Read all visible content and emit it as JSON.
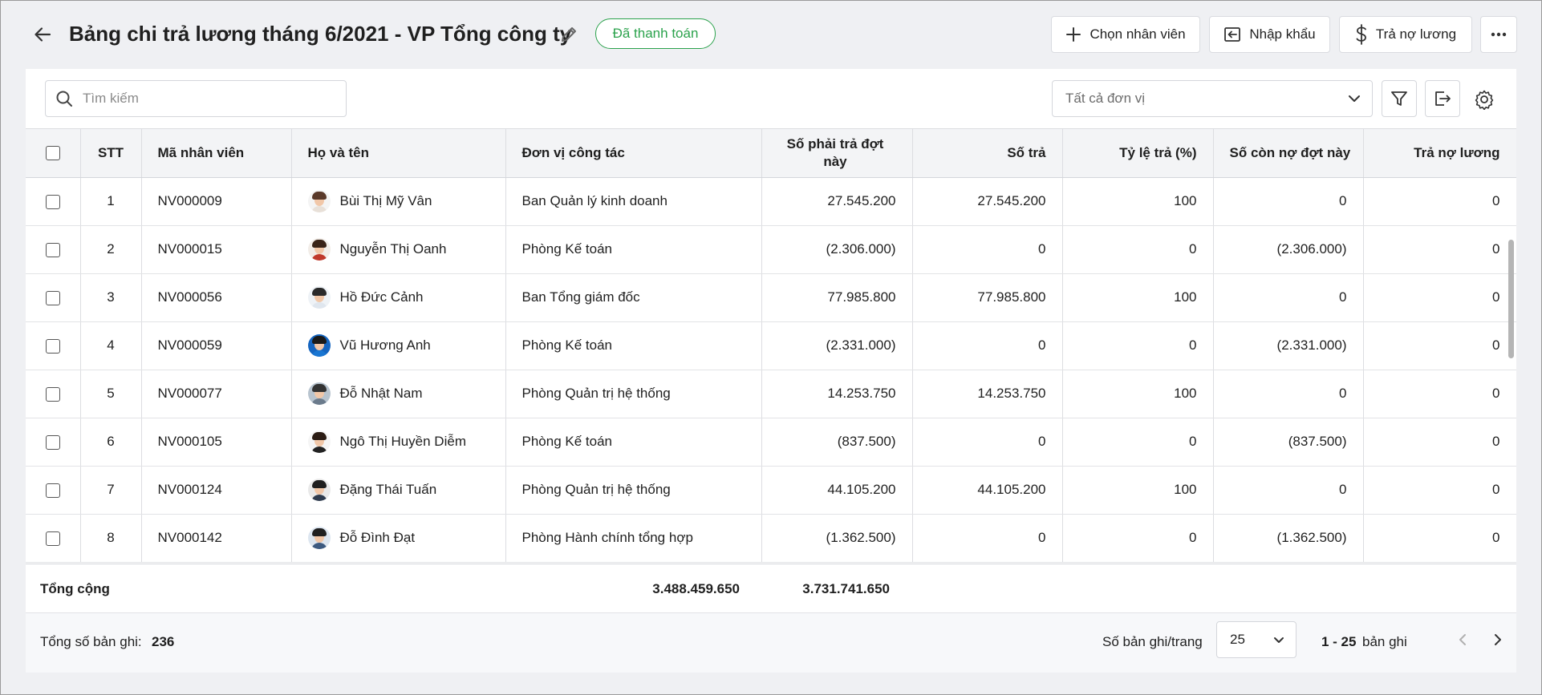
{
  "header": {
    "title": "Bảng chi trả lương tháng 6/2021 - VP Tổng công ty",
    "status": "Đã thanh toán",
    "buttons": {
      "choose_employee": "Chọn nhân viên",
      "import": "Nhập khẩu",
      "pay_debt": "Trả nợ lương"
    }
  },
  "toolbar": {
    "search_placeholder": "Tìm kiếm",
    "unit_filter": "Tất cả đơn vị"
  },
  "table": {
    "columns": {
      "stt": "STT",
      "code": "Mã nhân viên",
      "name": "Họ và tên",
      "unit": "Đơn vị công tác",
      "payable": "Số phải trả đợt này",
      "paid": "Số trả",
      "rate": "Tỷ lệ trả (%)",
      "remaining": "Số còn nợ đợt này",
      "debt_paid": "Trả nợ lương"
    },
    "rows": [
      {
        "stt": "1",
        "code": "NV000009",
        "name": "Bùi Thị Mỹ Vân",
        "unit": "Ban Quản lý kinh doanh",
        "payable": "27.545.200",
        "paid": "27.545.200",
        "rate": "100",
        "remaining": "0",
        "debt_paid": "0"
      },
      {
        "stt": "2",
        "code": "NV000015",
        "name": "Nguyễn Thị Oanh",
        "unit": "Phòng Kế toán",
        "payable": "(2.306.000)",
        "paid": "0",
        "rate": "0",
        "remaining": "(2.306.000)",
        "debt_paid": "0"
      },
      {
        "stt": "3",
        "code": "NV000056",
        "name": "Hồ Đức Cảnh",
        "unit": "Ban Tổng giám đốc",
        "payable": "77.985.800",
        "paid": "77.985.800",
        "rate": "100",
        "remaining": "0",
        "debt_paid": "0"
      },
      {
        "stt": "4",
        "code": "NV000059",
        "name": "Vũ Hương Anh",
        "unit": "Phòng Kế toán",
        "payable": "(2.331.000)",
        "paid": "0",
        "rate": "0",
        "remaining": "(2.331.000)",
        "debt_paid": "0"
      },
      {
        "stt": "5",
        "code": "NV000077",
        "name": "Đỗ Nhật Nam",
        "unit": "Phòng Quản trị hệ thống",
        "payable": "14.253.750",
        "paid": "14.253.750",
        "rate": "100",
        "remaining": "0",
        "debt_paid": "0"
      },
      {
        "stt": "6",
        "code": "NV000105",
        "name": "Ngô Thị Huyền Diễm",
        "unit": "Phòng Kế toán",
        "payable": "(837.500)",
        "paid": "0",
        "rate": "0",
        "remaining": "(837.500)",
        "debt_paid": "0"
      },
      {
        "stt": "7",
        "code": "NV000124",
        "name": "Đặng Thái Tuấn",
        "unit": "Phòng Quản trị hệ thống",
        "payable": "44.105.200",
        "paid": "44.105.200",
        "rate": "100",
        "remaining": "0",
        "debt_paid": "0"
      },
      {
        "stt": "8",
        "code": "NV000142",
        "name": "Đỗ Đình Đạt",
        "unit": "Phòng Hành chính tổng hợp",
        "payable": "(1.362.500)",
        "paid": "0",
        "rate": "0",
        "remaining": "(1.362.500)",
        "debt_paid": "0"
      }
    ],
    "avatar_colors": [
      {
        "hair": "#5a3a2a",
        "body": "#e8e0d8",
        "bg": "#f4f4f4"
      },
      {
        "hair": "#3a2418",
        "body": "#c0392b",
        "bg": "#f2ede8"
      },
      {
        "hair": "#2a2a2a",
        "body": "#dfe6ee",
        "bg": "#eef2f6"
      },
      {
        "hair": "#1a1a1a",
        "body": "#1976d2",
        "bg": "#1565c0"
      },
      {
        "hair": "#333333",
        "body": "#6b7b8c",
        "bg": "#b8c4cf"
      },
      {
        "hair": "#2b1c14",
        "body": "#222222",
        "bg": "#f5f5f5"
      },
      {
        "hair": "#1f1f1f",
        "body": "#2e3b4e",
        "bg": "#e9e9e9"
      },
      {
        "hair": "#202020",
        "body": "#3d5a80",
        "bg": "#dde6f0"
      }
    ]
  },
  "totals": {
    "label": "Tổng cộng",
    "payable": "3.488.459.650",
    "paid": "3.731.741.650"
  },
  "footer": {
    "total_records_label": "Tổng số bản ghi:",
    "total_records": "236",
    "per_page_label": "Số bản ghi/trang",
    "per_page": "25",
    "range": "1 - 25",
    "range_suffix": "bản ghi"
  },
  "colors": {
    "accent_green": "#2ba24c",
    "background": "#eff0f3"
  }
}
